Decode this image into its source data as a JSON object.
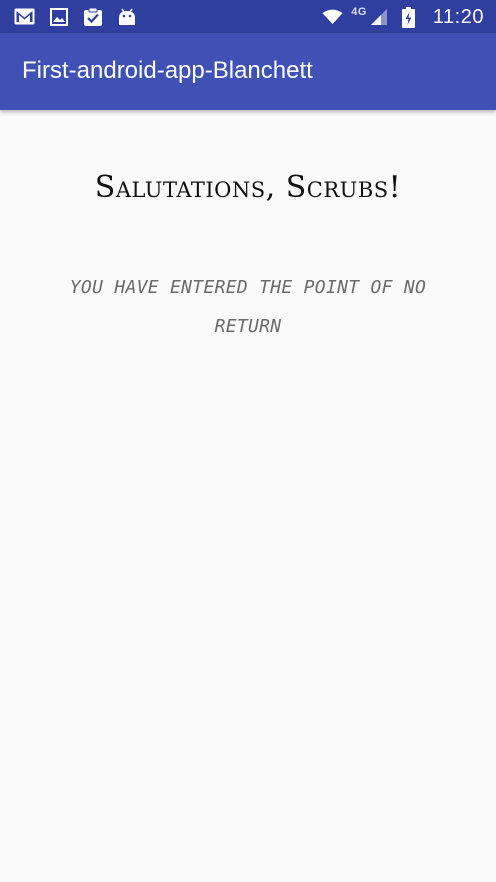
{
  "status_bar": {
    "time": "11:20",
    "network_type": "4G",
    "left_icons": [
      "gmail-icon",
      "photo-icon",
      "task-check-icon",
      "android-debug-icon"
    ],
    "right_icons": [
      "wifi-icon",
      "cell-signal-icon",
      "battery-charging-icon"
    ]
  },
  "app_bar": {
    "title": "First-android-app-Blanchett"
  },
  "main": {
    "greeting": "Salutations, Scrubs!",
    "warning": "YOU HAVE ENTERED THE POINT OF NO RETURN"
  },
  "colors": {
    "status_bar": "#303f9f",
    "app_bar": "#3f51b5",
    "background": "#fafafa",
    "greeting_text": "#111111",
    "warning_text": "#6b6b6b"
  }
}
